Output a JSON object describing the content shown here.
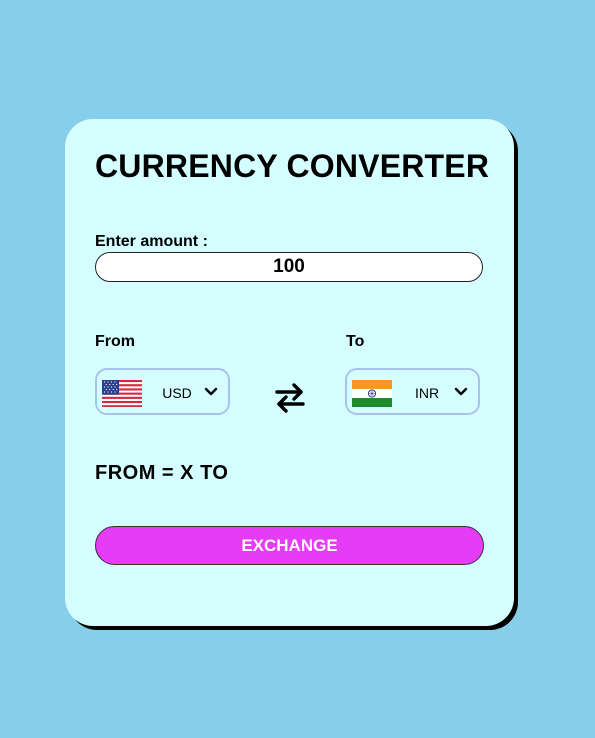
{
  "app": {
    "title": "CURRENCY CONVERTER"
  },
  "amount": {
    "label": "Enter amount :",
    "value": "100"
  },
  "from": {
    "label": "From",
    "currency": "USD",
    "flag": "us-flag-icon"
  },
  "to": {
    "label": "To",
    "currency": "INR",
    "flag": "india-flag-icon"
  },
  "swap": {
    "icon": "swap-arrows-icon"
  },
  "result": {
    "text": "FROM = X TO"
  },
  "actions": {
    "exchange_label": "EXCHANGE"
  },
  "colors": {
    "background": "#87ceeb",
    "card": "#d4feff",
    "button": "#e63bf7",
    "select_border": "#a8c4ea"
  }
}
